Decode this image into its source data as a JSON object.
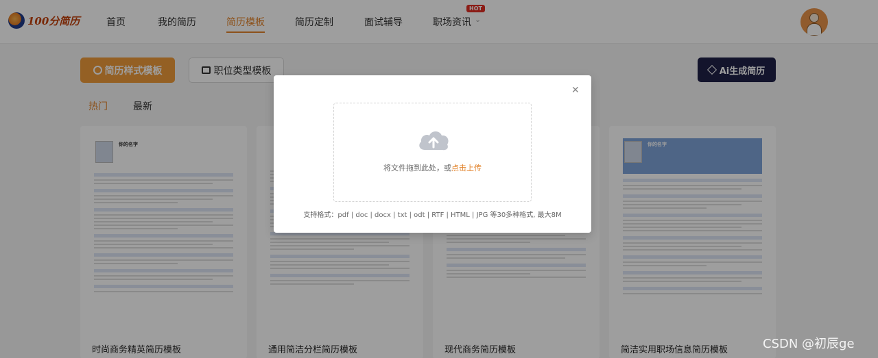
{
  "brand": {
    "logo_text": "100分简历"
  },
  "nav": {
    "items": [
      {
        "label": "首页"
      },
      {
        "label": "我的简历"
      },
      {
        "label": "简历模板",
        "active": true
      },
      {
        "label": "简历定制"
      },
      {
        "label": "面试辅导"
      },
      {
        "label": "职场资讯",
        "badge": "HOT"
      }
    ]
  },
  "toolbar": {
    "style_templates_label": "简历样式模板",
    "job_templates_label": "职位类型模板",
    "ai_label": "Ai生成简历"
  },
  "tabs": {
    "hot": "热门",
    "latest": "最新"
  },
  "cards": [
    {
      "title": "时尚商务精英简历模板",
      "name": "你的名字"
    },
    {
      "title": "通用简洁分栏简历模板"
    },
    {
      "title": "现代商务简历模板"
    },
    {
      "title": "简洁实用职场信息简历模板",
      "name": "你的名字"
    }
  ],
  "upload_modal": {
    "drop_text": "将文件拖到此处，或",
    "upload_link": "点击上传",
    "formats": "支持格式：pdf | doc | docx | txt | odt | RTF | HTML | JPG 等30多种格式, 最大8M"
  },
  "watermark": "CSDN @初辰ge",
  "colors": {
    "accent": "#ef9b3a",
    "ai_button": "#1f2147",
    "hot_badge": "#e02e24"
  },
  "icons": [
    "palette-icon",
    "briefcase-icon",
    "sparkle-icon",
    "close-icon",
    "cloud-upload-icon",
    "chevron-down-icon"
  ]
}
